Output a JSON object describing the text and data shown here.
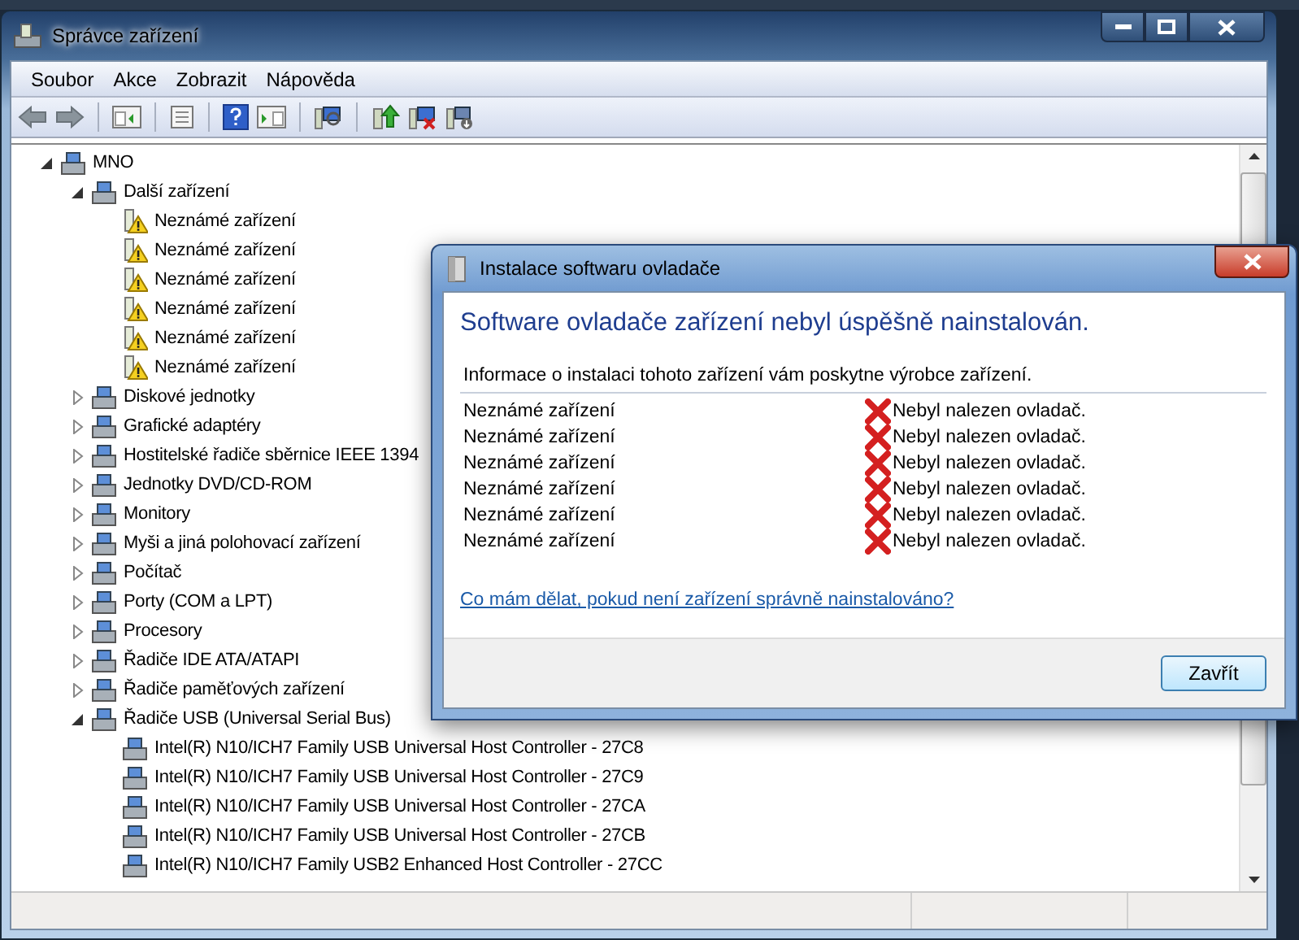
{
  "window": {
    "title": "Správce zařízení"
  },
  "menu": [
    "Soubor",
    "Akce",
    "Zobrazit",
    "Nápověda"
  ],
  "tree": {
    "label": "MNO",
    "expanded": true,
    "children": [
      {
        "label": "Další zařízení",
        "expanded": true,
        "children": [
          {
            "label": "Neznámé zařízení",
            "warning": true
          },
          {
            "label": "Neznámé zařízení",
            "warning": true
          },
          {
            "label": "Neznámé zařízení",
            "warning": true
          },
          {
            "label": "Neznámé zařízení",
            "warning": true
          },
          {
            "label": "Neznámé zařízení",
            "warning": true
          },
          {
            "label": "Neznámé zařízení",
            "warning": true
          }
        ]
      },
      {
        "label": "Diskové jednotky",
        "expanded": false
      },
      {
        "label": "Grafické adaptéry",
        "expanded": false
      },
      {
        "label": "Hostitelské řadiče sběrnice IEEE 1394",
        "expanded": false
      },
      {
        "label": "Jednotky DVD/CD-ROM",
        "expanded": false
      },
      {
        "label": "Monitory",
        "expanded": false
      },
      {
        "label": "Myši a jiná polohovací zařízení",
        "expanded": false
      },
      {
        "label": "Počítač",
        "expanded": false
      },
      {
        "label": "Porty (COM a LPT)",
        "expanded": false
      },
      {
        "label": "Procesory",
        "expanded": false
      },
      {
        "label": "Řadiče IDE ATA/ATAPI",
        "expanded": false
      },
      {
        "label": "Řadiče paměťových zařízení",
        "expanded": false
      },
      {
        "label": "Řadiče USB (Universal Serial Bus)",
        "expanded": true,
        "children": [
          {
            "label": "Intel(R) N10/ICH7 Family USB Universal Host Controller - 27C8"
          },
          {
            "label": "Intel(R) N10/ICH7 Family USB Universal Host Controller - 27C9"
          },
          {
            "label": "Intel(R) N10/ICH7 Family USB Universal Host Controller - 27CA"
          },
          {
            "label": "Intel(R) N10/ICH7 Family USB Universal Host Controller - 27CB"
          },
          {
            "label": "Intel(R) N10/ICH7 Family USB2 Enhanced Host Controller - 27CC"
          }
        ]
      }
    ]
  },
  "dialog": {
    "title": "Instalace softwaru ovladače",
    "heading": "Software ovladače zařízení nebyl úspěšně nainstalován.",
    "info": "Informace o instalaci tohoto zařízení vám poskytne výrobce zařízení.",
    "devices": [
      {
        "name": "Neznámé zařízení",
        "status": "Nebyl nalezen ovladač."
      },
      {
        "name": "Neznámé zařízení",
        "status": "Nebyl nalezen ovladač."
      },
      {
        "name": "Neznámé zařízení",
        "status": "Nebyl nalezen ovladač."
      },
      {
        "name": "Neznámé zařízení",
        "status": "Nebyl nalezen ovladač."
      },
      {
        "name": "Neznámé zařízení",
        "status": "Nebyl nalezen ovladač."
      },
      {
        "name": "Neznámé zařízení",
        "status": "Nebyl nalezen ovladač."
      }
    ],
    "help_link": "Co mám dělat, pokud není zařízení správně nainstalováno?",
    "buttons": [
      "Zavřít"
    ]
  }
}
